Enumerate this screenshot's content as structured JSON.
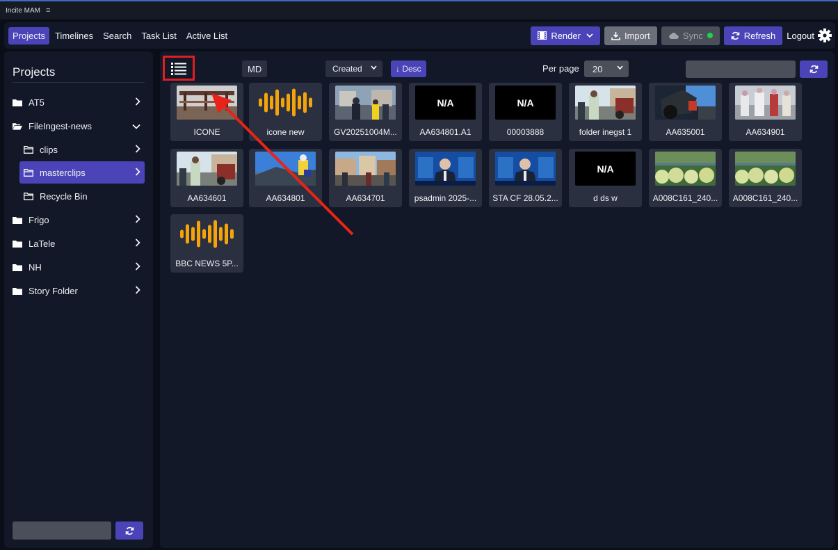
{
  "app": {
    "title": "Incite MAM",
    "menu_icon": "hamburger-icon"
  },
  "nav": {
    "items": [
      {
        "label": "Projects",
        "active": true
      },
      {
        "label": "Timelines"
      },
      {
        "label": "Search"
      },
      {
        "label": "Task List"
      },
      {
        "label": "Active List"
      }
    ],
    "render_label": "Render",
    "import_label": "Import",
    "sync_label": "Sync",
    "refresh_label": "Refresh",
    "logout_label": "Logout"
  },
  "sidebar": {
    "title": "Projects",
    "items": [
      {
        "label": "AT5",
        "icon": "folder-icon"
      },
      {
        "label": "FileIngest-news",
        "icon": "folder-open-icon"
      },
      {
        "label": "clips",
        "icon": "folder-outline-icon"
      },
      {
        "label": "masterclips",
        "icon": "folder-outline-icon",
        "selected": true
      },
      {
        "label": "Recycle Bin",
        "icon": "folder-outline-icon"
      },
      {
        "label": "Frigo",
        "icon": "folder-icon"
      },
      {
        "label": "LaTele",
        "icon": "folder-icon"
      },
      {
        "label": "NH",
        "icon": "folder-icon"
      },
      {
        "label": "Story Folder",
        "icon": "folder-icon"
      }
    ]
  },
  "toolbar": {
    "md_label": "MD",
    "sort_value": "Created",
    "order_label": "↓ Desc",
    "per_page_label": "Per page",
    "per_page_value": "20"
  },
  "assets": [
    {
      "label": "ICONE",
      "thumb": "bridge"
    },
    {
      "label": "icone new",
      "thumb": "audio"
    },
    {
      "label": "GV20251004M...",
      "thumb": "police"
    },
    {
      "label": "AA634801.A1",
      "thumb": "na"
    },
    {
      "label": "00003888",
      "thumb": "na"
    },
    {
      "label": "folder inegst 1",
      "thumb": "street"
    },
    {
      "label": "AA635001",
      "thumb": "tractor"
    },
    {
      "label": "AA634901",
      "thumb": "crowd"
    },
    {
      "label": "AA634601",
      "thumb": "street"
    },
    {
      "label": "AA634801",
      "thumb": "sky"
    },
    {
      "label": "AA634701",
      "thumb": "town"
    },
    {
      "label": "psadmin 2025-...",
      "thumb": "news"
    },
    {
      "label": "STA CF 28.05.2...",
      "thumb": "news"
    },
    {
      "label": "d ds w",
      "thumb": "na"
    },
    {
      "label": "A008C161_240...",
      "thumb": "apples"
    },
    {
      "label": "A008C161_240...",
      "thumb": "apples"
    },
    {
      "label": "BBC NEWS 5P...",
      "thumb": "audio"
    }
  ],
  "na_text": "N/A",
  "colors": {
    "accent": "#4b44b8",
    "panel": "#121827",
    "card": "#2a3040",
    "audio": "#f5a30a",
    "annotation": "#e02020",
    "sync_ok": "#1dd34a"
  }
}
